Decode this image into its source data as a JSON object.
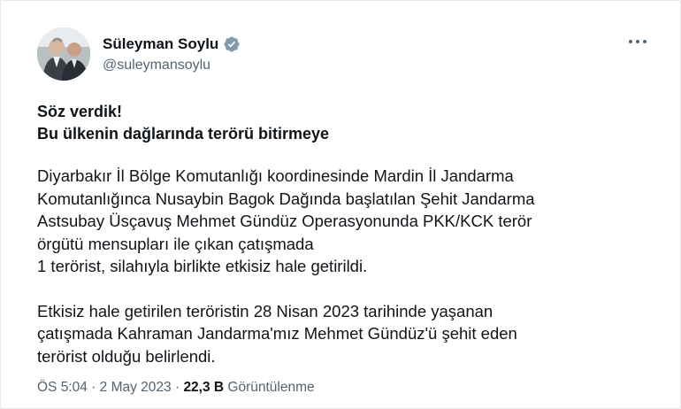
{
  "author": {
    "display_name": "Süleyman Soylu",
    "handle": "@suleymansoylu",
    "verified": true,
    "verified_color": "#829aab"
  },
  "tweet": {
    "headline_lines": [
      "Söz verdik!",
      "Bu ülkenin dağlarında terörü bitirmeye"
    ],
    "paragraph1_lines": [
      "Diyarbakır İl Bölge Komutanlığı koordinesinde Mardin İl Jandarma",
      "Komutanlığınca Nusaybin Bagok Dağında başlatılan Şehit Jandarma",
      "Astsubay Üsçavuş Mehmet Gündüz Operasyonunda PKK/KCK terör",
      "örgütü mensupları ile çıkan çatışmada",
      "1 terörist, silahıyla birlikte etkisiz hale getirildi."
    ],
    "paragraph2_lines": [
      "Etkisiz hale getirilen teröristin 28 Nisan 2023 tarihinde yaşanan",
      "çatışmada Kahraman Jandarma'mız Mehmet Gündüz'ü şehit eden",
      "terörist olduğu belirlendi."
    ]
  },
  "meta": {
    "time": "ÖS 5:04",
    "separator": " · ",
    "date": "2 May 2023",
    "views_count": "22,3 B",
    "views_label": " Görüntülenme"
  },
  "icons": {
    "more": "more-horizontal-icon",
    "verified": "verified-badge-icon"
  }
}
